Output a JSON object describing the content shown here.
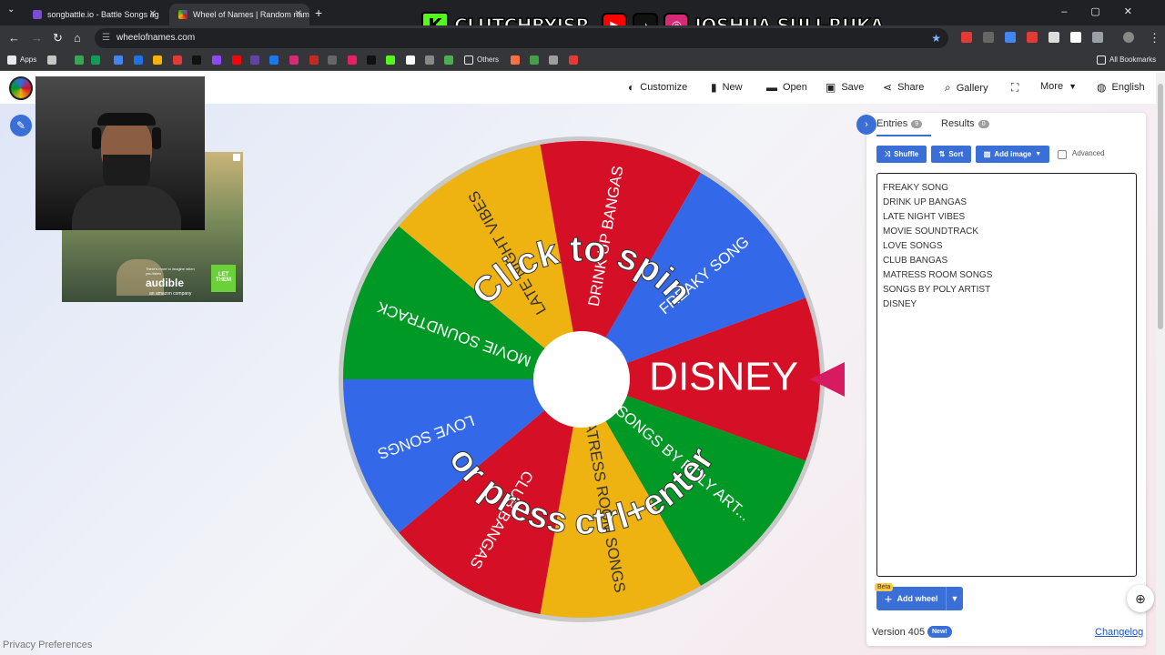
{
  "browser": {
    "tabs": [
      {
        "title": "songbattle.io - Battle Songs ag"
      },
      {
        "title": "Wheel of Names | Random nam"
      }
    ],
    "url": "wheelofnames.com",
    "bookmarks": {
      "apps": "Apps",
      "others": "Others",
      "all": "All Bookmarks"
    }
  },
  "overlay": {
    "channel": "CLUTCHBYJSR",
    "name": "JOSHUA SULI-RUKA"
  },
  "appbar": {
    "customize": "Customize",
    "new": "New",
    "open": "Open",
    "save": "Save",
    "share": "Share",
    "gallery": "Gallery",
    "more": "More",
    "language": "English"
  },
  "wheel": {
    "segments": [
      {
        "label": "DISNEY",
        "color": "#d50f25"
      },
      {
        "label": "SONGS BY POLY ART...",
        "color": "#009925"
      },
      {
        "label": "MATRESS ROOM SONGS",
        "color": "#eeb211"
      },
      {
        "label": "CLUB BANGAS",
        "color": "#d50f25"
      },
      {
        "label": "LOVE SONGS",
        "color": "#3369e8"
      },
      {
        "label": "MOVIE SOUNDTRACK",
        "color": "#009925"
      },
      {
        "label": "LATE NIGHT VIBES",
        "color": "#eeb211"
      },
      {
        "label": "DRINK UP BANGAS",
        "color": "#d50f25"
      },
      {
        "label": "FREAKY SONG",
        "color": "#3369e8"
      }
    ],
    "prompt_top": "Click to spin",
    "prompt_bottom": "or press ctrl+enter"
  },
  "ad": {
    "tagline": "There's more to imagine when you listen",
    "brand": "audible",
    "sub": "an amazon company",
    "cta": "LET THEM"
  },
  "panel": {
    "tabs": {
      "entries": "Entries",
      "entries_count": "9",
      "results": "Results",
      "results_count": "0"
    },
    "buttons": {
      "shuffle": "Shuffle",
      "sort": "Sort",
      "add_image": "Add image",
      "advanced": "Advanced"
    },
    "entries": [
      "FREAKY SONG",
      "DRINK UP BANGAS",
      "LATE NIGHT VIBES",
      "MOVIE SOUNDTRACK",
      "LOVE SONGS",
      "CLUB BANGAS",
      "MATRESS ROOM SONGS",
      "SONGS BY POLY ARTIST",
      "DISNEY"
    ],
    "add_wheel": "Add wheel",
    "beta": "Beta",
    "version": "Version 405",
    "new_badge": "New!",
    "changelog": "Changelog"
  },
  "footer": {
    "privacy": "Privacy Preferences"
  }
}
